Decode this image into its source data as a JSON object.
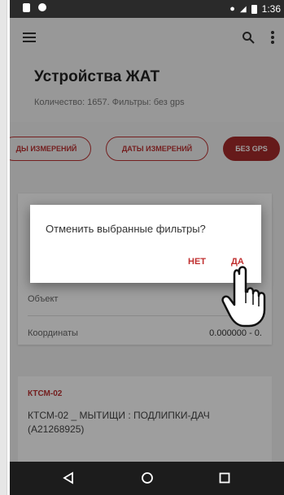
{
  "status_bar": {
    "time": "1:36",
    "icons": [
      "sim-icon",
      "notification-icon",
      "location-icon",
      "signal-icon",
      "battery-icon"
    ]
  },
  "app_bar": {
    "menu_icon": "hamburger-icon",
    "search_icon": "search-icon",
    "more_icon": "more-vert-icon"
  },
  "header": {
    "title": "Устройства ЖАТ",
    "subtitle": "Количество: 1657. Фильтры: без gps"
  },
  "chips": [
    {
      "label": "ДЫ ИЗМЕРЕНИЙ"
    },
    {
      "label": "ДАТЫ ИЗМЕРЕНИЙ"
    },
    {
      "label": "БЕЗ GPS"
    }
  ],
  "card1": {
    "object_label": "Объект",
    "coords_label": "Координаты",
    "coords_value": "0.000000 - 0."
  },
  "card2": {
    "code": "КТСМ-02",
    "name": "КТСМ-02 _ МЫТИЩИ : ПОДЛИПКИ-ДАЧ (A21268925)"
  },
  "dialog": {
    "question": "Отменить выбранные фильтры?",
    "no_label": "НЕТ",
    "yes_label": "ДА"
  },
  "navbar": {
    "back_icon": "back-triangle-icon",
    "home_icon": "home-circle-icon",
    "recents_icon": "recents-square-icon"
  },
  "colors": {
    "accent": "#a52a2a",
    "statusbar": "#2a2a2a",
    "navbar": "#1c1c1c"
  }
}
